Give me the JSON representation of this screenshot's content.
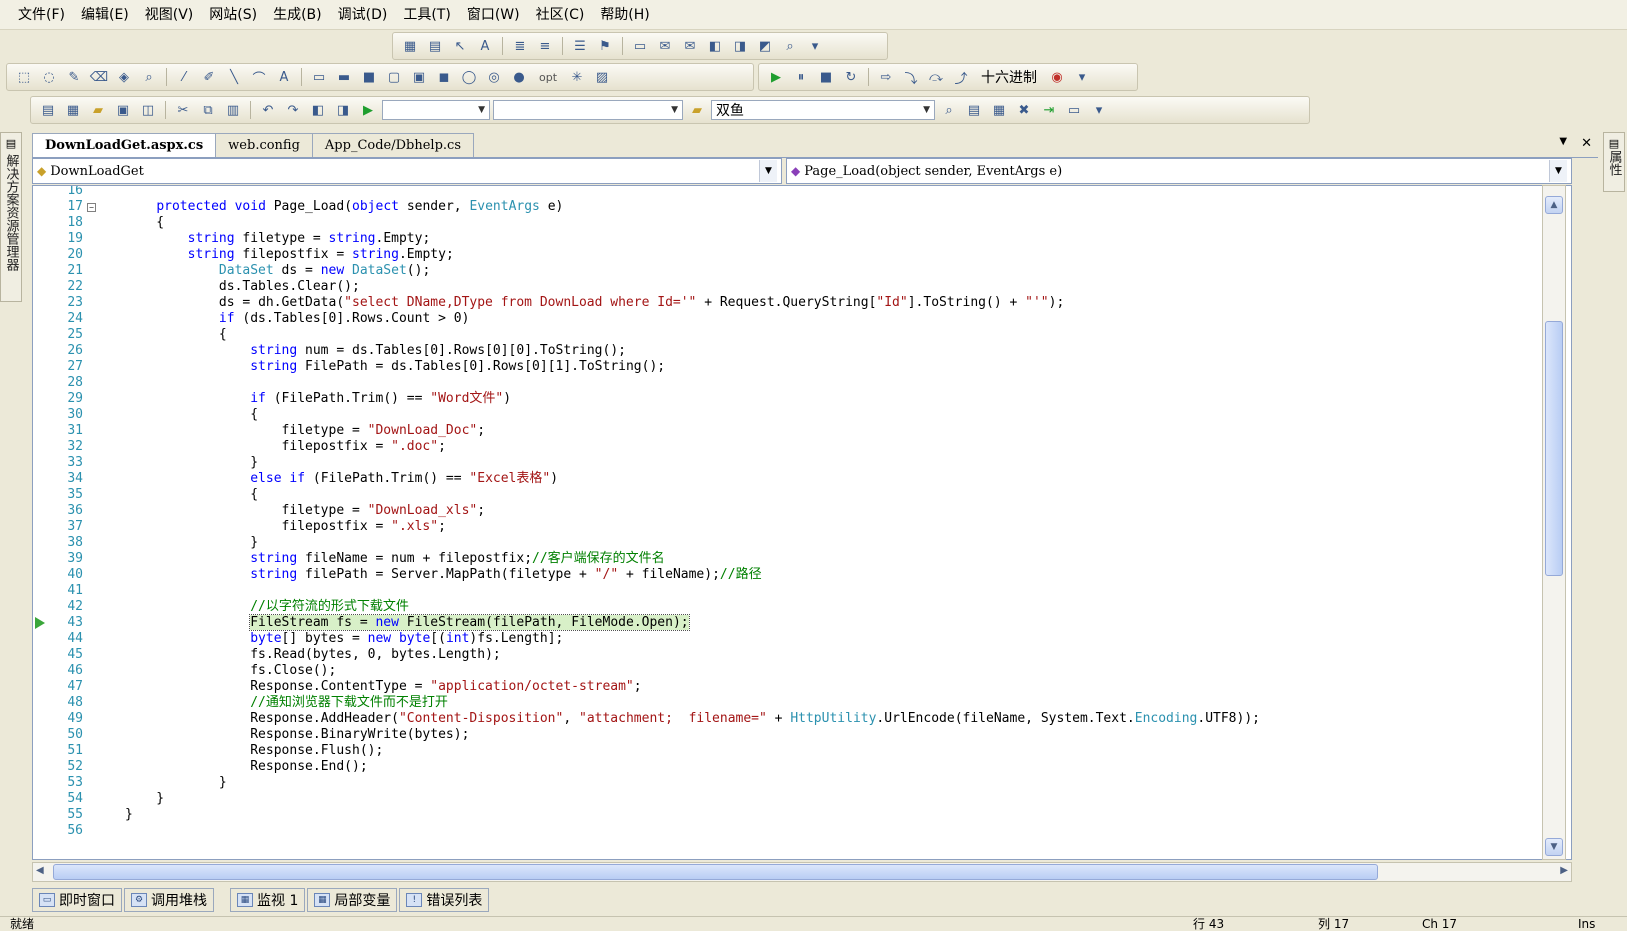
{
  "menu": [
    "文件(F)",
    "编辑(E)",
    "视图(V)",
    "网站(S)",
    "生成(B)",
    "调试(D)",
    "工具(T)",
    "窗口(W)",
    "社区(C)",
    "帮助(H)"
  ],
  "toolbar": {
    "hex_label": "十六进制",
    "opt_label": "opt",
    "solution_platform": "双鱼"
  },
  "side_panels": {
    "left": "解决方案资源管理器",
    "right": "属性"
  },
  "tabs": [
    "DownLoadGet.aspx.cs",
    "web.config",
    "App_Code/Dbhelp.cs"
  ],
  "tab_controls": {
    "dropdown": "▼",
    "close": "✕"
  },
  "navigation": {
    "class_combo": "DownLoadGet",
    "member_combo": "Page_Load(object sender, EventArgs e)"
  },
  "code": {
    "current_line": 43,
    "lines": [
      {
        "n": "16",
        "t": ""
      },
      {
        "n": "17",
        "t": "    protected void Page_Load(object sender, EventArgs e)"
      },
      {
        "n": "18",
        "t": "    {"
      },
      {
        "n": "19",
        "t": "        string filetype = string.Empty;"
      },
      {
        "n": "20",
        "t": "        string filepostfix = string.Empty;"
      },
      {
        "n": "21",
        "t": "            DataSet ds = new DataSet();"
      },
      {
        "n": "22",
        "t": "            ds.Tables.Clear();"
      },
      {
        "n": "23",
        "t": "            ds = dh.GetData(\"select DName,DType from DownLoad where Id='\" + Request.QueryString[\"Id\"].ToString() + \"'\");"
      },
      {
        "n": "24",
        "t": "            if (ds.Tables[0].Rows.Count > 0)"
      },
      {
        "n": "25",
        "t": "            {"
      },
      {
        "n": "26",
        "t": "                string num = ds.Tables[0].Rows[0][0].ToString();"
      },
      {
        "n": "27",
        "t": "                string FilePath = ds.Tables[0].Rows[0][1].ToString();"
      },
      {
        "n": "28",
        "t": ""
      },
      {
        "n": "29",
        "t": "                if (FilePath.Trim() == \"Word文件\")"
      },
      {
        "n": "30",
        "t": "                {"
      },
      {
        "n": "31",
        "t": "                    filetype = \"DownLoad_Doc\";"
      },
      {
        "n": "32",
        "t": "                    filepostfix = \".doc\";"
      },
      {
        "n": "33",
        "t": "                }"
      },
      {
        "n": "34",
        "t": "                else if (FilePath.Trim() == \"Excel表格\")"
      },
      {
        "n": "35",
        "t": "                {"
      },
      {
        "n": "36",
        "t": "                    filetype = \"DownLoad_xls\";"
      },
      {
        "n": "37",
        "t": "                    filepostfix = \".xls\";"
      },
      {
        "n": "38",
        "t": "                }"
      },
      {
        "n": "39",
        "t": "                string fileName = num + filepostfix;//客户端保存的文件名"
      },
      {
        "n": "40",
        "t": "                string filePath = Server.MapPath(filetype + \"/\" + fileName);//路径"
      },
      {
        "n": "41",
        "t": ""
      },
      {
        "n": "42",
        "t": "                //以字符流的形式下载文件"
      },
      {
        "n": "43",
        "t": "                FileStream fs = new FileStream(filePath, FileMode.Open);"
      },
      {
        "n": "44",
        "t": "                byte[] bytes = new byte[(int)fs.Length];"
      },
      {
        "n": "45",
        "t": "                fs.Read(bytes, 0, bytes.Length);"
      },
      {
        "n": "46",
        "t": "                fs.Close();"
      },
      {
        "n": "47",
        "t": "                Response.ContentType = \"application/octet-stream\";"
      },
      {
        "n": "48",
        "t": "                //通知浏览器下载文件而不是打开"
      },
      {
        "n": "49",
        "t": "                Response.AddHeader(\"Content-Disposition\", \"attachment;  filename=\" + HttpUtility.UrlEncode(fileName, System.Text.Encoding.UTF8));"
      },
      {
        "n": "50",
        "t": "                Response.BinaryWrite(bytes);"
      },
      {
        "n": "51",
        "t": "                Response.Flush();"
      },
      {
        "n": "52",
        "t": "                Response.End();"
      },
      {
        "n": "53",
        "t": "            }"
      },
      {
        "n": "54",
        "t": "    }"
      },
      {
        "n": "55",
        "t": "}"
      },
      {
        "n": "56",
        "t": ""
      }
    ]
  },
  "bottom_tabs": [
    "即时窗口",
    "调用堆栈",
    "监视 1",
    "局部变量",
    "错误列表"
  ],
  "status": {
    "ready": "就绪",
    "line": "行 43",
    "col": "列 17",
    "ch": "Ch 17",
    "mode": "Ins"
  }
}
